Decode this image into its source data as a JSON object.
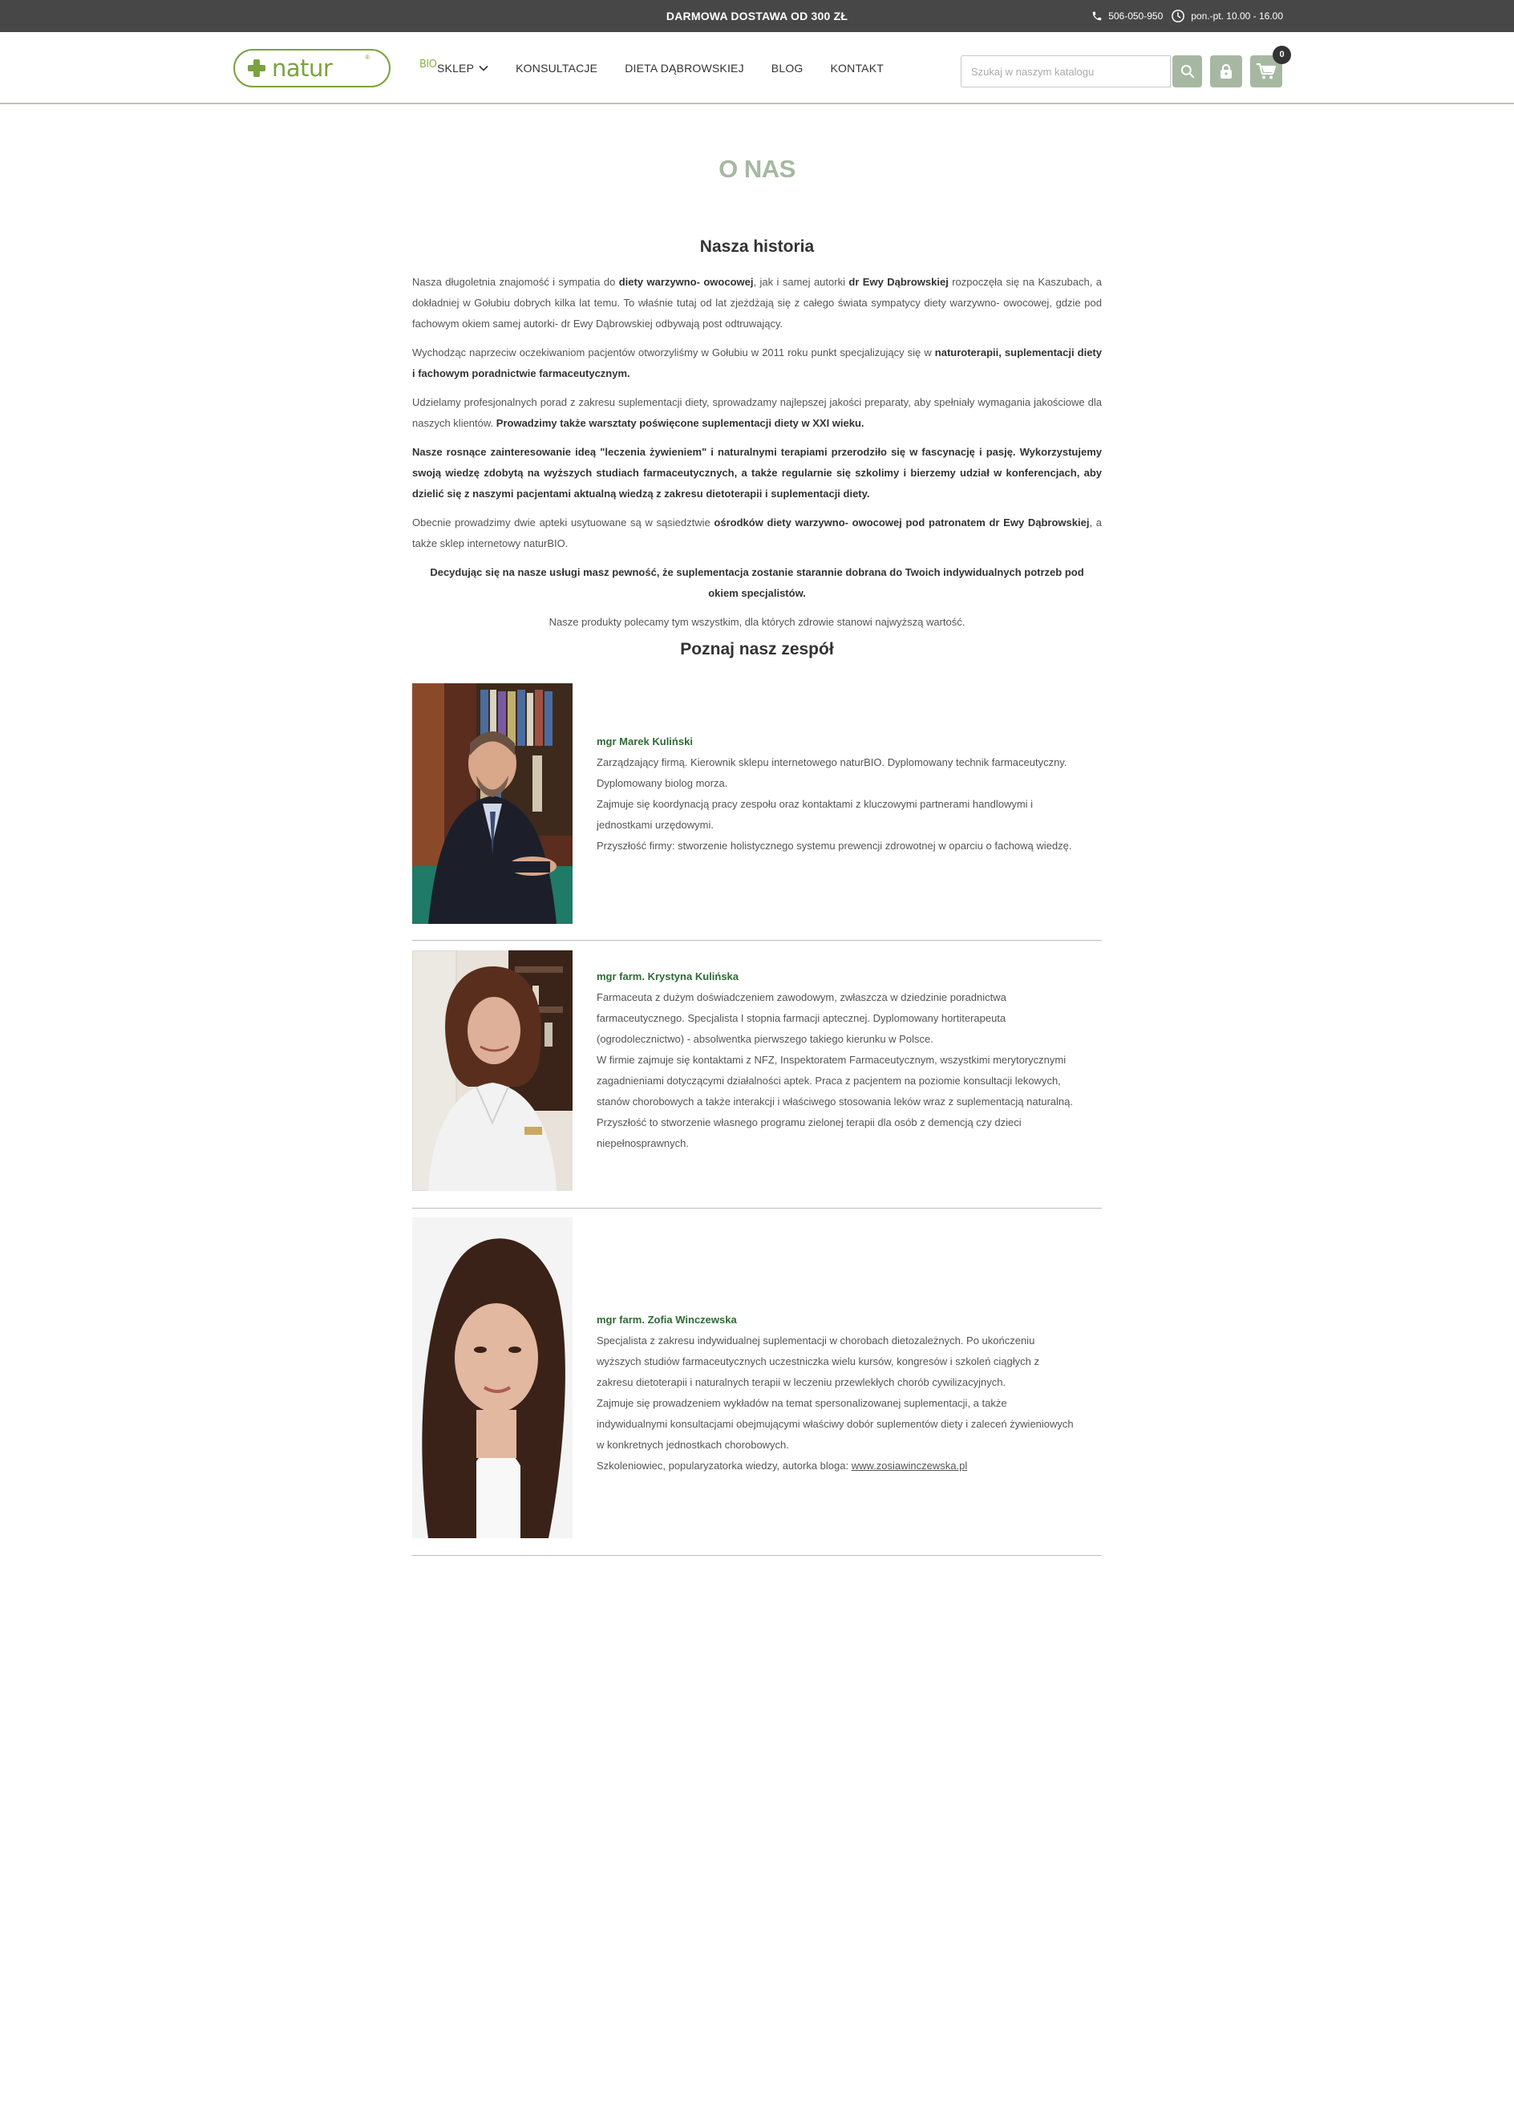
{
  "topbar": {
    "promo": "DARMOWA DOSTAWA OD 300 ZŁ",
    "phone": "506-050-950",
    "hours": "pon.-pt. 10.00 - 16.00"
  },
  "header": {
    "logo_text": "naturBIO",
    "nav": [
      "SKLEP",
      "KONSULTACJE",
      "DIETA DĄBROWSKIEJ",
      "BLOG",
      "KONTAKT"
    ],
    "search_placeholder": "Szukaj w naszym katalogu",
    "cart_count": "0"
  },
  "page": {
    "title": "O NAS",
    "history_heading": "Nasza historia",
    "team_heading": "Poznaj nasz zespół"
  },
  "history": [
    {
      "segments": [
        {
          "t": "Nasza długoletnia znajomość i sympatia do ",
          "b": false
        },
        {
          "t": "diety warzywno- owocowej",
          "b": true
        },
        {
          "t": ", jak i samej autorki ",
          "b": false
        },
        {
          "t": "dr Ewy Dąbrowskiej",
          "b": true
        },
        {
          "t": " rozpoczęła się na Kaszubach, a dokładniej w Gołubiu dobrych kilka lat temu. To właśnie tutaj od lat zjeżdżają się z całego świata sympatycy diety warzywno- owocowej, gdzie pod fachowym okiem samej autorki- dr Ewy Dąbrowskiej odbywają post odtruwający.",
          "b": false
        }
      ]
    },
    {
      "segments": [
        {
          "t": "Wychodząc naprzeciw oczekiwaniom pacjentów otworzyliśmy w Gołubiu w 2011 roku punkt specjalizujący się w ",
          "b": false
        },
        {
          "t": "naturoterapii, suplementacji diety i fachowym poradnictwie farmaceutycznym.",
          "b": true
        }
      ]
    },
    {
      "segments": [
        {
          "t": "Udzielamy profesjonalnych porad z zakresu suplementacji diety, sprowadzamy najlepszej jakości preparaty, aby spełniały wymagania jakościowe dla naszych klientów. ",
          "b": false
        },
        {
          "t": "Prowadzimy także warsztaty poświęcone suplementacji diety w XXI wieku.",
          "b": true
        }
      ]
    },
    {
      "segments": [
        {
          "t": "Nasze rosnące zainteresowanie ideą \"leczenia żywieniem\" i naturalnymi terapiami przerodziło się w fascynację i pasję. Wykorzystujemy swoją wiedzę zdobytą na wyższych studiach farmaceutycznych, a także regularnie się szkolimy i bierzemy udział w konferencjach, aby dzielić się z naszymi pacjentami aktualną wiedzą z zakresu dietoterapii i suplementacji diety.",
          "b": true
        }
      ]
    },
    {
      "segments": [
        {
          "t": "Obecnie prowadzimy dwie apteki usytuowane są w sąsiedztwie ",
          "b": false
        },
        {
          "t": "ośrodków diety warzywno- owocowej pod patronatem dr Ewy Dąbrowskiej",
          "b": true
        },
        {
          "t": ", a także sklep internetowy naturBIO.",
          "b": false
        }
      ]
    },
    {
      "segments": [
        {
          "t": "Decydując się na nasze usługi masz pewność, że suplementacja zostanie starannie dobrana do Twoich indywidualnych potrzeb pod okiem specjalistów.",
          "b": true
        }
      ]
    },
    {
      "segments": [
        {
          "t": "Nasze produkty polecamy tym wszystkim, dla których zdrowie stanowi najwyższą wartość.",
          "b": false
        }
      ]
    }
  ],
  "team": [
    {
      "name": "mgr Marek Kuliński",
      "lines": [
        "Zarządzający firmą. Kierownik sklepu internetowego naturBIO. Dyplomowany technik farmaceutyczny. Dyplomowany biolog morza.",
        "Zajmuje się koordynacją pracy zespołu oraz kontaktami z kluczowymi partnerami handlowymi i jednostkami urzędowymi.",
        "Przyszłość firmy: stworzenie holistycznego systemu prewencji zdrowotnej w oparciu o fachową wiedzę."
      ]
    },
    {
      "name": "mgr farm. Krystyna Kulińska",
      "lines": [
        "Farmaceuta z dużym doświadczeniem zawodowym, zwłaszcza w dziedzinie poradnictwa farmaceutycznego. Specjalista I stopnia farmacji aptecznej. Dyplomowany hortiterapeuta (ogrodolecznictwo) - absolwentka pierwszego takiego kierunku w Polsce.",
        "W firmie zajmuje się kontaktami z NFZ, Inspektoratem Farmaceutycznym, wszystkimi merytorycznymi zagadnieniami dotyczącymi działalności aptek. Praca z pacjentem na poziomie konsultacji lekowych, stanów chorobowych a także interakcji i właściwego stosowania leków wraz z suplementacją naturalną.",
        "Przyszłość to stworzenie własnego programu zielonej terapii dla osób z demencją czy dzieci niepełnosprawnych."
      ]
    },
    {
      "name": "mgr farm. Zofia Winczewska",
      "lines": [
        "Specjalista z zakresu indywidualnej suplementacji w chorobach dietozależnych. Po ukończeniu wyższych studiów farmaceutycznych uczestniczka wielu kursów, kongresów i szkoleń ciągłych z zakresu dietoterapii i naturalnych terapii w leczeniu przewlekłych chorób cywilizacyjnych.",
        "Zajmuje się prowadzeniem wykładów na temat spersonalizowanej suplementacji, a także indywidualnymi konsultacjami obejmującymi właściwy dobór suplementów diety i zaleceń żywieniowych w konkretnych jednostkach chorobowych."
      ],
      "last_line_prefix": "Szkoleniowiec, popularyzatorka wiedzy, autorka bloga: ",
      "blog_link": "www.zosiawinczewska.pl"
    }
  ],
  "colors": {
    "accent_green": "#7aa33f",
    "sage": "#a6b8a2",
    "name_green": "#2e6b34",
    "topbar": "#474747"
  }
}
